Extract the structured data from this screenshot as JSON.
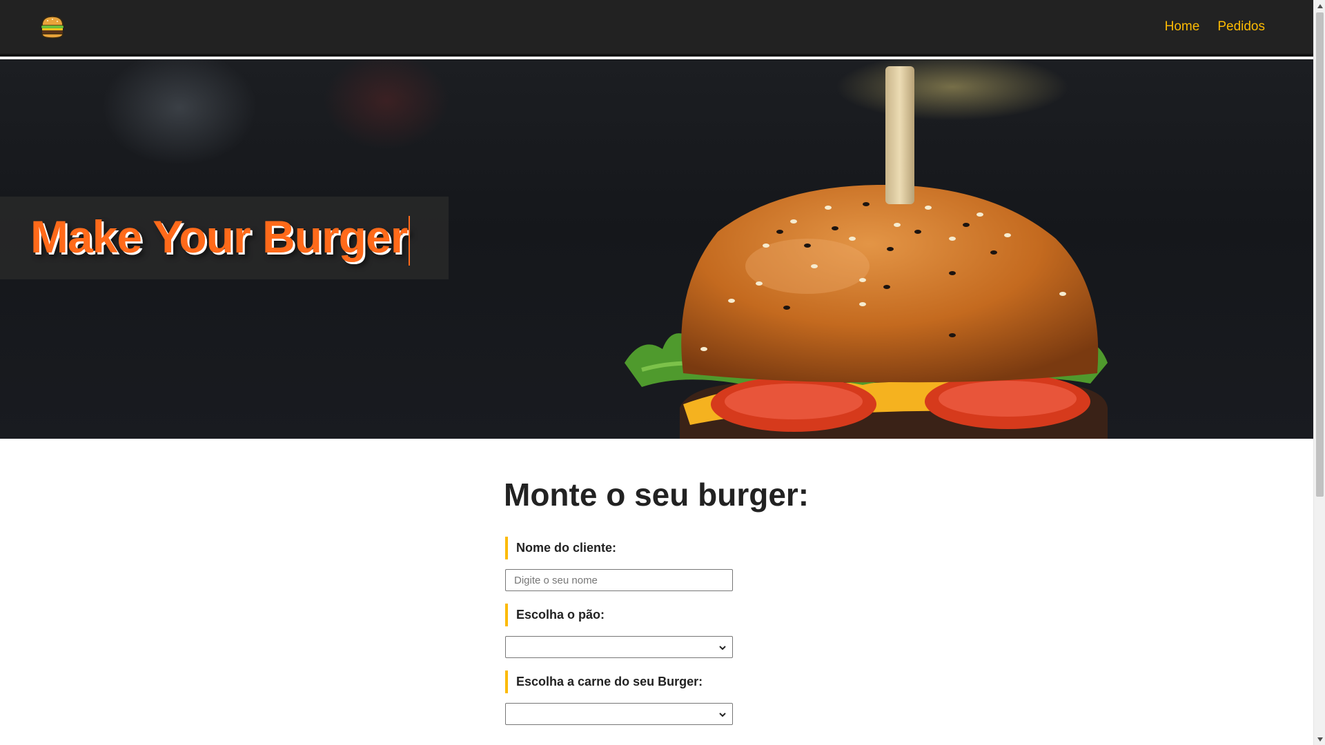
{
  "navbar": {
    "logo_icon": "burger-icon",
    "links": [
      {
        "label": "Home"
      },
      {
        "label": "Pedidos"
      }
    ],
    "link_color": "#fcba03"
  },
  "hero": {
    "title": "Make Your Burger",
    "image": "burger-photo",
    "title_color": "#ff6a1a"
  },
  "form": {
    "title": "Monte o seu burger:",
    "fields": {
      "name": {
        "label": "Nome do cliente:",
        "placeholder": "Digite o seu nome",
        "value": ""
      },
      "bread": {
        "label": "Escolha o pão:",
        "selected": ""
      },
      "meat": {
        "label": "Escolha a carne do seu Burger:",
        "selected": ""
      }
    },
    "accent_color": "#fcba03"
  }
}
